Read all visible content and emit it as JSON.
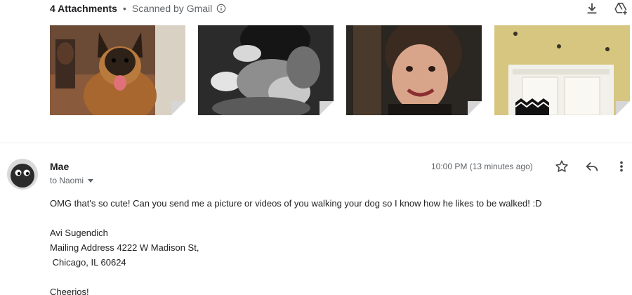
{
  "attachments": {
    "count_label": "4 Attachments",
    "separator": "•",
    "scanned_label": "Scanned by Gmail",
    "icons": {
      "info": "info-icon",
      "download": "download-icon",
      "drive": "add-to-drive-icon"
    },
    "items": [
      {
        "description": "german-shepherd-dog-photo"
      },
      {
        "description": "black-and-white-person-hugging-dog-photo"
      },
      {
        "description": "smiling-woman-selfie-photo"
      },
      {
        "description": "room-wall-with-dresser-photo"
      }
    ]
  },
  "message": {
    "sender": "Mae",
    "recipient": "to Naomi",
    "timestamp": "10:00 PM (13 minutes ago)",
    "icons": {
      "star": "star-icon",
      "reply": "reply-icon",
      "more": "more-vert-icon",
      "recipient_caret": "caret-down-icon"
    },
    "body": {
      "line1": "OMG that's so cute! Can you send me a picture or videos of you walking your dog so I know how he likes to be walked! :D",
      "sig_name": "Avi Sugendich",
      "sig_address1": "Mailing Address 4222 W Madison St,",
      "sig_address2": " Chicago, IL 60624",
      "closing": "Cheerios!"
    }
  },
  "colors": {
    "text_primary": "#202124",
    "text_secondary": "#5f6368",
    "divider": "#eceff1"
  }
}
